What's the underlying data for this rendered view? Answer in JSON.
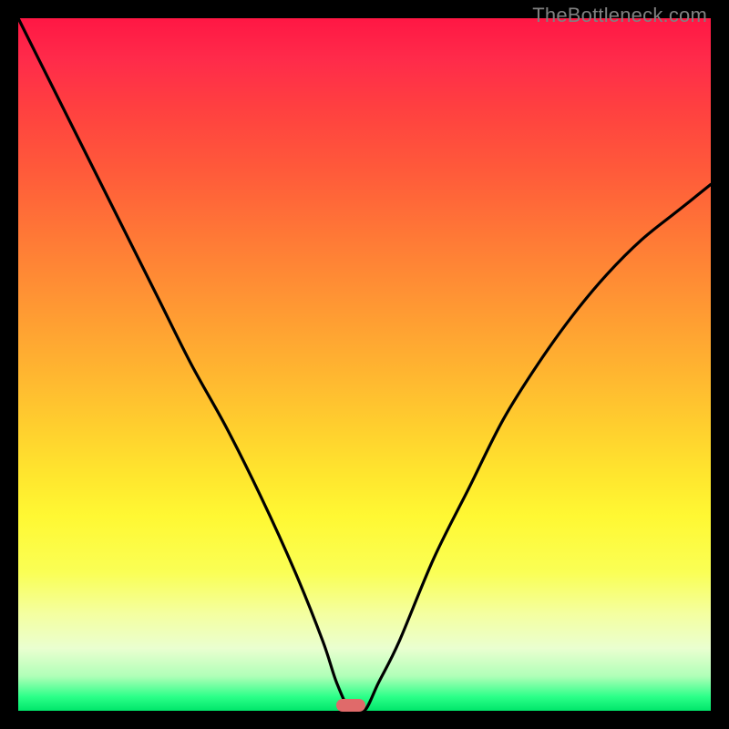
{
  "attribution": "TheBottleneck.com",
  "colors": {
    "bg": "#000000",
    "gradient_top": "#ff1744",
    "gradient_mid": "#ffe62e",
    "gradient_bottom": "#00e66a",
    "curve": "#000000",
    "marker": "#e06a6a"
  },
  "chart_data": {
    "type": "line",
    "title": "",
    "xlabel": "",
    "ylabel": "",
    "xlim": [
      0,
      100
    ],
    "ylim": [
      0,
      100
    ],
    "minimum_at_x": 48,
    "series": [
      {
        "name": "bottleneck-curve",
        "x": [
          0,
          5,
          10,
          15,
          20,
          25,
          30,
          35,
          40,
          44,
          46,
          48,
          50,
          52,
          55,
          60,
          65,
          70,
          75,
          80,
          85,
          90,
          95,
          100
        ],
        "y": [
          100,
          90,
          80,
          70,
          60,
          50,
          41,
          31,
          20,
          10,
          4,
          0,
          0,
          4,
          10,
          22,
          32,
          42,
          50,
          57,
          63,
          68,
          72,
          76
        ]
      }
    ],
    "annotations": []
  }
}
